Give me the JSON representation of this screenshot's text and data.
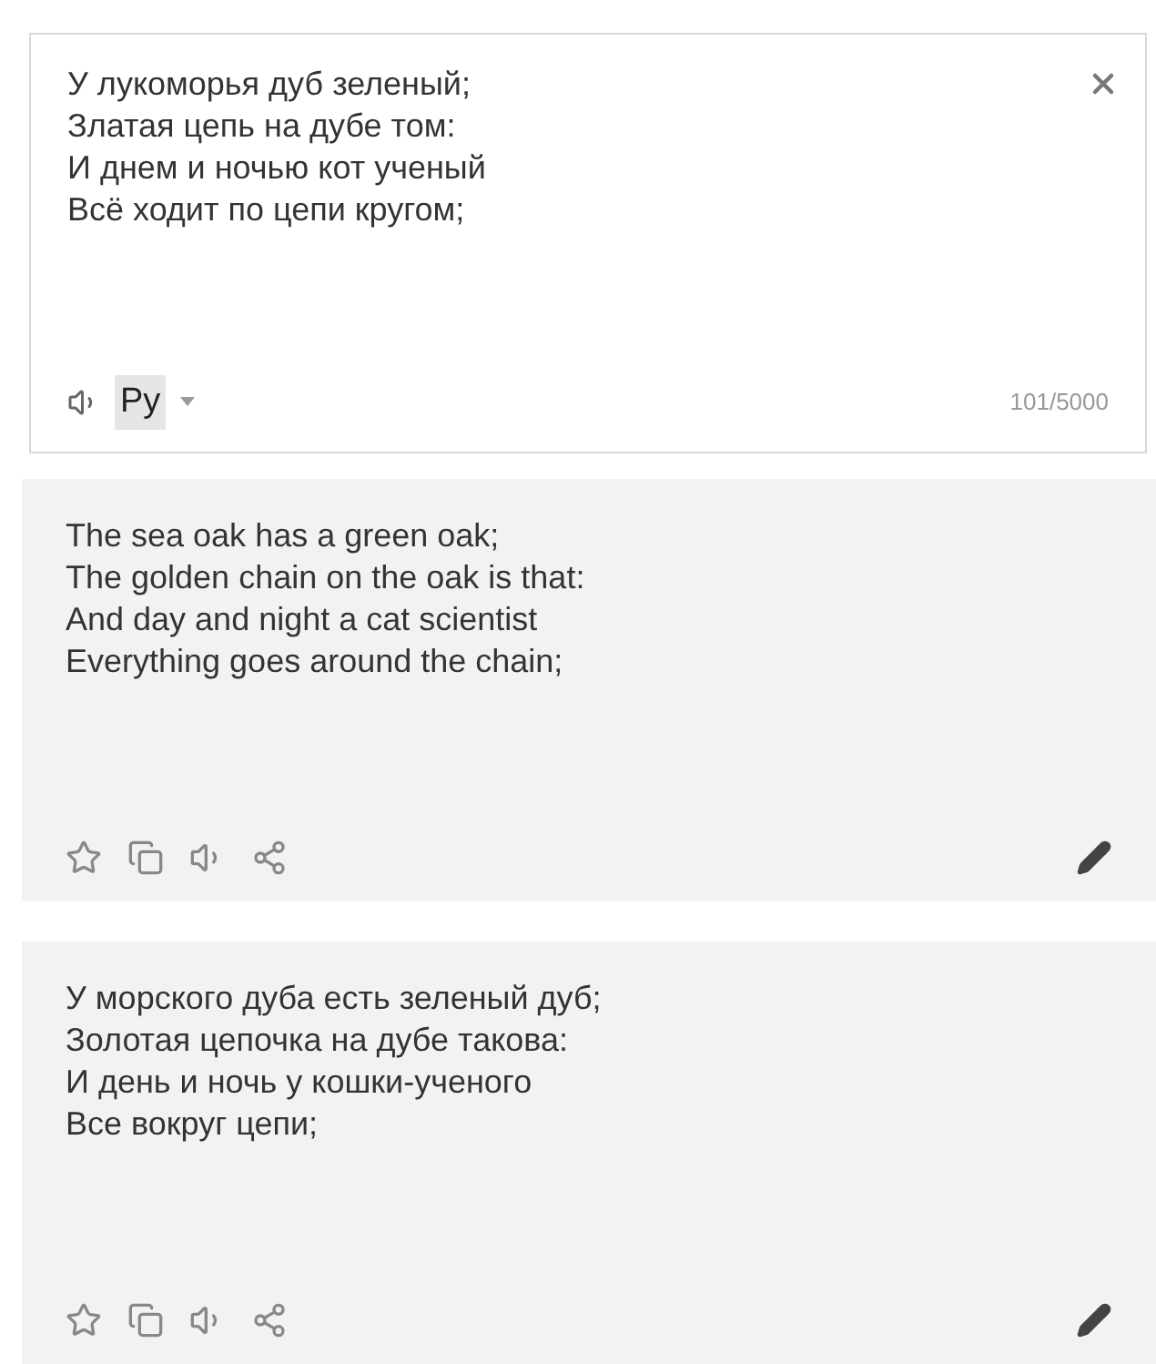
{
  "source": {
    "lines": [
      "У лукоморья дуб зеленый;",
      "Златая цепь на дубе том:",
      "И днем и ночью кот ученый",
      "Всё ходит по цепи кругом;"
    ],
    "language": "Ру",
    "counter": "101/5000"
  },
  "translations": [
    {
      "lines": [
        "The sea oak has a green oak;",
        "The golden chain on the oak is that:",
        "And day and night a cat scientist",
        "Everything goes around the chain;"
      ]
    },
    {
      "lines": [
        "У морского дуба есть зеленый дуб;",
        "Золотая цепочка на дубе такова:",
        "И день и ночь у кошки-ученого",
        "Все вокруг цепи;"
      ]
    }
  ]
}
